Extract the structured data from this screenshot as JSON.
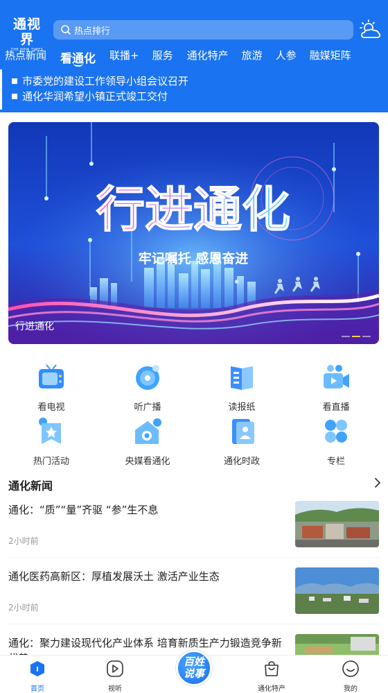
{
  "header": {
    "logo_text": "通视界",
    "logo_subtext": "THE NEW TIMES",
    "search_placeholder": "热点排行",
    "weather_icon": "sun-cloud-icon"
  },
  "tabs": [
    {
      "label": "热点新闻",
      "active": false
    },
    {
      "label": "看通化",
      "active": true
    },
    {
      "label": "联播+",
      "active": false
    },
    {
      "label": "服务",
      "active": false
    },
    {
      "label": "通化特产",
      "active": false
    },
    {
      "label": "旅游",
      "active": false
    },
    {
      "label": "人参",
      "active": false
    },
    {
      "label": "融媒矩阵",
      "active": false
    }
  ],
  "marquee": [
    "市委党的建设工作领导小组会议召开",
    "通化华润希望小镇正式竣工交付"
  ],
  "banner": {
    "headline": "行进通化",
    "slogan": "牢记嘱托 感恩奋进",
    "caption": "行进通化",
    "slide_count": 3,
    "active_slide": 2
  },
  "services": [
    {
      "label": "看电视",
      "icon": "tv-icon"
    },
    {
      "label": "听广播",
      "icon": "radio-disc-icon"
    },
    {
      "label": "读报纸",
      "icon": "newspaper-icon"
    },
    {
      "label": "看直播",
      "icon": "live-camera-icon"
    },
    {
      "label": "热门活动",
      "icon": "activity-star-icon"
    },
    {
      "label": "央媒看通化",
      "icon": "central-media-icon"
    },
    {
      "label": "通化时政",
      "icon": "politics-icon"
    },
    {
      "label": "专栏",
      "icon": "column-grid-icon"
    }
  ],
  "news_section": {
    "title": "通化新闻",
    "items": [
      {
        "title": "通化：“质”“量”齐驱 “参”生不息",
        "time": "2小时前"
      },
      {
        "title": "通化医药高新区：厚植发展沃土 激活产业生态",
        "time": "2小时前"
      },
      {
        "title": "通化：聚力建设现代化产业体系 培育新质生产力锻造竞争新优势",
        "time": ""
      }
    ]
  },
  "bottom_nav": [
    {
      "label": "首页",
      "icon": "home-icon",
      "active": true
    },
    {
      "label": "视听",
      "icon": "play-icon",
      "active": false
    },
    {
      "label": "百姓说事",
      "icon": "speak-badge-icon",
      "active": false
    },
    {
      "label": "通化特产",
      "icon": "shopping-bag-icon",
      "active": false
    },
    {
      "label": "我的",
      "icon": "smile-icon",
      "active": false
    }
  ],
  "colors": {
    "brand": "#1a73f0",
    "highlight": "#ffcf4d"
  }
}
